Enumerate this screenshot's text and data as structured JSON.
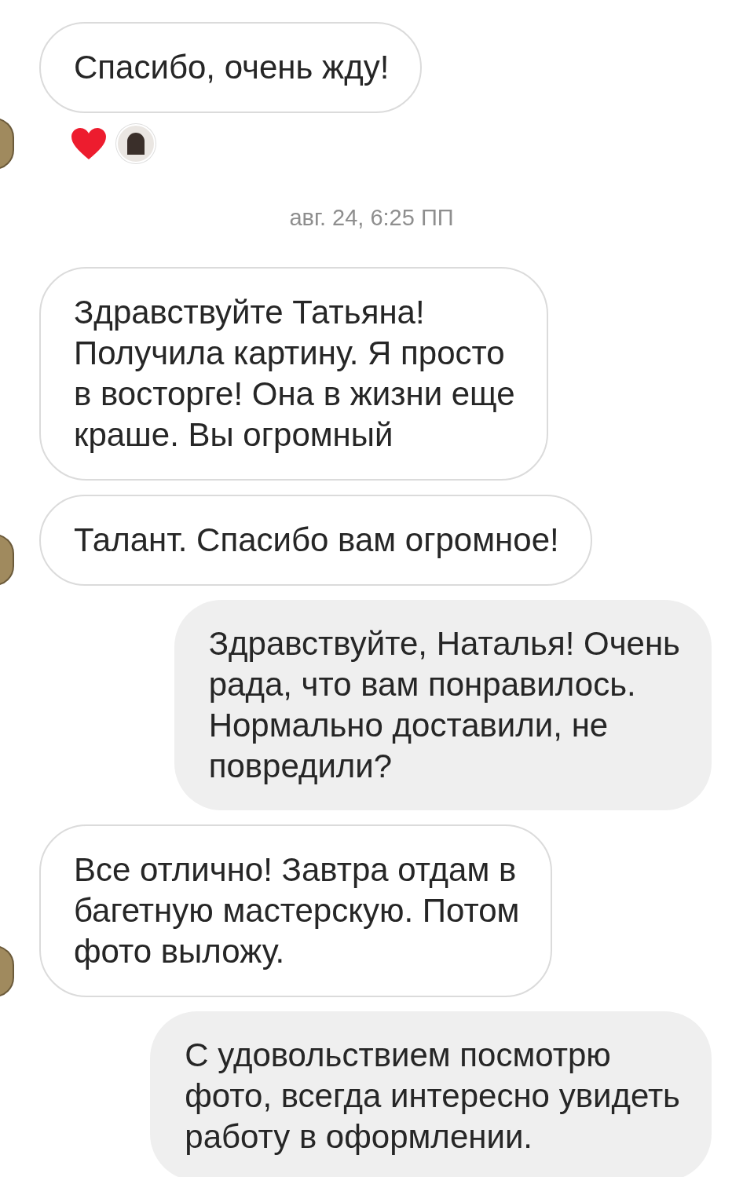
{
  "messages": [
    {
      "kind": "incoming",
      "text": "Спасибо, очень жду!",
      "avatar": true,
      "reacted": true
    },
    {
      "kind": "timestamp",
      "text": "авг. 24, 6:25 ПП"
    },
    {
      "kind": "incoming",
      "text": "Здравствуйте Татьяна!\nПолучила картину. Я просто\nв восторге! Она в жизни еще\nкраше. Вы огромный",
      "avatar": false,
      "reacted": false
    },
    {
      "kind": "incoming",
      "text": "Талант. Спасибо вам огромное!",
      "avatar": true,
      "reacted": false
    },
    {
      "kind": "outgoing",
      "text": "Здравствуйте, Наталья! Очень\nрада, что вам понравилось.\nНормально доставили, не\nповредили?"
    },
    {
      "kind": "incoming",
      "text": "Все отлично! Завтра отдам в\nбагетную мастерскую. Потом\nфото выложу.",
      "avatar": true,
      "reacted": false
    },
    {
      "kind": "outgoing",
      "text": "С удовольствием посмотрю\nфото, всегда интересно увидеть\nработу в оформлении."
    }
  ]
}
